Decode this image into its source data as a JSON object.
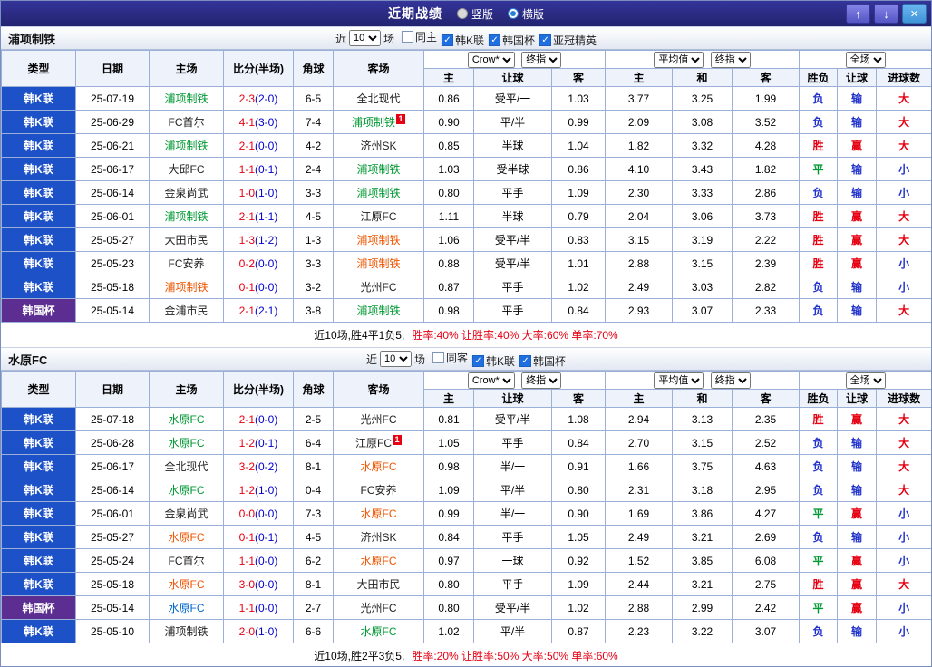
{
  "titlebar": {
    "title": "近期战绩",
    "radio_vertical": "竖版",
    "radio_horizontal": "横版",
    "up_icon": "↑",
    "down_icon": "↓",
    "close_icon": "×"
  },
  "colors": {
    "league": {
      "韩K联": "#1c51c8",
      "韩国杯": "#5c2e91"
    },
    "team": {
      "green": "#009933",
      "red": "#ee5500",
      "blue": "#0066cc",
      "black": "#222222"
    },
    "score_full": "#e60012",
    "score_half": "#0000cc",
    "result": {
      "胜": "#e60012",
      "平": "#009933",
      "负": "#2233cc",
      "赢": "#e60012",
      "输": "#2233cc",
      "大": "#e60012",
      "小": "#2233cc"
    }
  },
  "sections": [
    {
      "team": "浦项制铁",
      "filter": {
        "prefix": "近",
        "count": "10",
        "suffix": "场",
        "checkboxes": [
          {
            "label": "同主",
            "checked": false
          },
          {
            "label": "韩K联",
            "checked": true
          },
          {
            "label": "韩国杯",
            "checked": true
          },
          {
            "label": "亚冠精英",
            "checked": true
          }
        ]
      },
      "table": {
        "headers": [
          "类型",
          "日期",
          "主场",
          "比分(半场)",
          "角球",
          "客场"
        ],
        "odds_group1": {
          "select1": "Crow*",
          "select2": "终指",
          "cols": [
            "主",
            "让球",
            "客"
          ]
        },
        "odds_group2": {
          "select1": "平均值",
          "select2": "终指",
          "cols": [
            "主",
            "和",
            "客"
          ]
        },
        "result_group": {
          "select1": "全场",
          "cols": [
            "胜负",
            "让球",
            "进球数"
          ]
        },
        "rows": [
          {
            "league": "韩K联",
            "date": "25-07-19",
            "home": {
              "name": "浦项制铁",
              "c": "green"
            },
            "score": {
              "full": "2-3",
              "half": "(2-0)"
            },
            "corner": "6-5",
            "away": {
              "name": "全北现代",
              "c": "black"
            },
            "odds1": [
              "0.86",
              "受平/一",
              "1.03"
            ],
            "odds2": [
              "3.77",
              "3.25",
              "1.99"
            ],
            "result": [
              "负",
              "输",
              "大"
            ]
          },
          {
            "league": "韩K联",
            "date": "25-06-29",
            "home": {
              "name": "FC首尔",
              "c": "black"
            },
            "score": {
              "full": "4-1",
              "half": "(3-0)"
            },
            "corner": "7-4",
            "away": {
              "name": "浦项制铁",
              "c": "green",
              "badge": "1"
            },
            "odds1": [
              "0.90",
              "平/半",
              "0.99"
            ],
            "odds2": [
              "2.09",
              "3.08",
              "3.52"
            ],
            "result": [
              "负",
              "输",
              "大"
            ]
          },
          {
            "league": "韩K联",
            "date": "25-06-21",
            "home": {
              "name": "浦项制铁",
              "c": "green"
            },
            "score": {
              "full": "2-1",
              "half": "(0-0)"
            },
            "corner": "4-2",
            "away": {
              "name": "济州SK",
              "c": "black"
            },
            "odds1": [
              "0.85",
              "半球",
              "1.04"
            ],
            "odds2": [
              "1.82",
              "3.32",
              "4.28"
            ],
            "result": [
              "胜",
              "赢",
              "大"
            ]
          },
          {
            "league": "韩K联",
            "date": "25-06-17",
            "home": {
              "name": "大邱FC",
              "c": "black"
            },
            "score": {
              "full": "1-1",
              "half": "(0-1)"
            },
            "corner": "2-4",
            "away": {
              "name": "浦项制铁",
              "c": "green"
            },
            "odds1": [
              "1.03",
              "受半球",
              "0.86"
            ],
            "odds2": [
              "4.10",
              "3.43",
              "1.82"
            ],
            "result": [
              "平",
              "输",
              "小"
            ]
          },
          {
            "league": "韩K联",
            "date": "25-06-14",
            "home": {
              "name": "金泉尚武",
              "c": "black"
            },
            "score": {
              "full": "1-0",
              "half": "(1-0)"
            },
            "corner": "3-3",
            "away": {
              "name": "浦项制铁",
              "c": "green"
            },
            "odds1": [
              "0.80",
              "平手",
              "1.09"
            ],
            "odds2": [
              "2.30",
              "3.33",
              "2.86"
            ],
            "result": [
              "负",
              "输",
              "小"
            ]
          },
          {
            "league": "韩K联",
            "date": "25-06-01",
            "home": {
              "name": "浦项制铁",
              "c": "green"
            },
            "score": {
              "full": "2-1",
              "half": "(1-1)"
            },
            "corner": "4-5",
            "away": {
              "name": "江原FC",
              "c": "black"
            },
            "odds1": [
              "1.11",
              "半球",
              "0.79"
            ],
            "odds2": [
              "2.04",
              "3.06",
              "3.73"
            ],
            "result": [
              "胜",
              "赢",
              "大"
            ]
          },
          {
            "league": "韩K联",
            "date": "25-05-27",
            "home": {
              "name": "大田市民",
              "c": "black"
            },
            "score": {
              "full": "1-3",
              "half": "(1-2)"
            },
            "corner": "1-3",
            "away": {
              "name": "浦项制铁",
              "c": "red"
            },
            "odds1": [
              "1.06",
              "受平/半",
              "0.83"
            ],
            "odds2": [
              "3.15",
              "3.19",
              "2.22"
            ],
            "result": [
              "胜",
              "赢",
              "大"
            ]
          },
          {
            "league": "韩K联",
            "date": "25-05-23",
            "home": {
              "name": "FC安养",
              "c": "black"
            },
            "score": {
              "full": "0-2",
              "half": "(0-0)"
            },
            "corner": "3-3",
            "away": {
              "name": "浦项制铁",
              "c": "red"
            },
            "odds1": [
              "0.88",
              "受平/半",
              "1.01"
            ],
            "odds2": [
              "2.88",
              "3.15",
              "2.39"
            ],
            "result": [
              "胜",
              "赢",
              "小"
            ]
          },
          {
            "league": "韩K联",
            "date": "25-05-18",
            "home": {
              "name": "浦项制铁",
              "c": "red"
            },
            "score": {
              "full": "0-1",
              "half": "(0-0)"
            },
            "corner": "3-2",
            "away": {
              "name": "光州FC",
              "c": "black"
            },
            "odds1": [
              "0.87",
              "平手",
              "1.02"
            ],
            "odds2": [
              "2.49",
              "3.03",
              "2.82"
            ],
            "result": [
              "负",
              "输",
              "小"
            ]
          },
          {
            "league": "韩国杯",
            "date": "25-05-14",
            "home": {
              "name": "金浦市民",
              "c": "black"
            },
            "score": {
              "full": "2-1",
              "half": "(2-1)"
            },
            "corner": "3-8",
            "away": {
              "name": "浦项制铁",
              "c": "green"
            },
            "odds1": [
              "0.98",
              "平手",
              "0.84"
            ],
            "odds2": [
              "2.93",
              "3.07",
              "2.33"
            ],
            "result": [
              "负",
              "输",
              "大"
            ]
          }
        ]
      },
      "summary": {
        "text": "近10场,胜4平1负5,",
        "stats": "胜率:40% 让胜率:40% 大率:60% 单率:70%"
      }
    },
    {
      "team": "水原FC",
      "filter": {
        "prefix": "近",
        "count": "10",
        "suffix": "场",
        "checkboxes": [
          {
            "label": "同客",
            "checked": false
          },
          {
            "label": "韩K联",
            "checked": true
          },
          {
            "label": "韩国杯",
            "checked": true
          }
        ]
      },
      "table": {
        "headers": [
          "类型",
          "日期",
          "主场",
          "比分(半场)",
          "角球",
          "客场"
        ],
        "odds_group1": {
          "select1": "Crow*",
          "select2": "终指",
          "cols": [
            "主",
            "让球",
            "客"
          ]
        },
        "odds_group2": {
          "select1": "平均值",
          "select2": "终指",
          "cols": [
            "主",
            "和",
            "客"
          ]
        },
        "result_group": {
          "select1": "全场",
          "cols": [
            "胜负",
            "让球",
            "进球数"
          ]
        },
        "rows": [
          {
            "league": "韩K联",
            "date": "25-07-18",
            "home": {
              "name": "水原FC",
              "c": "green"
            },
            "score": {
              "full": "2-1",
              "half": "(0-0)"
            },
            "corner": "2-5",
            "away": {
              "name": "光州FC",
              "c": "black"
            },
            "odds1": [
              "0.81",
              "受平/半",
              "1.08"
            ],
            "odds2": [
              "2.94",
              "3.13",
              "2.35"
            ],
            "result": [
              "胜",
              "赢",
              "大"
            ]
          },
          {
            "league": "韩K联",
            "date": "25-06-28",
            "home": {
              "name": "水原FC",
              "c": "green"
            },
            "score": {
              "full": "1-2",
              "half": "(0-1)"
            },
            "corner": "6-4",
            "away": {
              "name": "江原FC",
              "c": "black",
              "badge": "1"
            },
            "odds1": [
              "1.05",
              "平手",
              "0.84"
            ],
            "odds2": [
              "2.70",
              "3.15",
              "2.52"
            ],
            "result": [
              "负",
              "输",
              "大"
            ]
          },
          {
            "league": "韩K联",
            "date": "25-06-17",
            "home": {
              "name": "全北现代",
              "c": "black"
            },
            "score": {
              "full": "3-2",
              "half": "(0-2)"
            },
            "corner": "8-1",
            "away": {
              "name": "水原FC",
              "c": "red"
            },
            "odds1": [
              "0.98",
              "半/一",
              "0.91"
            ],
            "odds2": [
              "1.66",
              "3.75",
              "4.63"
            ],
            "result": [
              "负",
              "输",
              "大"
            ]
          },
          {
            "league": "韩K联",
            "date": "25-06-14",
            "home": {
              "name": "水原FC",
              "c": "green"
            },
            "score": {
              "full": "1-2",
              "half": "(1-0)"
            },
            "corner": "0-4",
            "away": {
              "name": "FC安养",
              "c": "black"
            },
            "odds1": [
              "1.09",
              "平/半",
              "0.80"
            ],
            "odds2": [
              "2.31",
              "3.18",
              "2.95"
            ],
            "result": [
              "负",
              "输",
              "大"
            ]
          },
          {
            "league": "韩K联",
            "date": "25-06-01",
            "home": {
              "name": "金泉尚武",
              "c": "black"
            },
            "score": {
              "full": "0-0",
              "half": "(0-0)"
            },
            "corner": "7-3",
            "away": {
              "name": "水原FC",
              "c": "red"
            },
            "odds1": [
              "0.99",
              "半/一",
              "0.90"
            ],
            "odds2": [
              "1.69",
              "3.86",
              "4.27"
            ],
            "result": [
              "平",
              "赢",
              "小"
            ]
          },
          {
            "league": "韩K联",
            "date": "25-05-27",
            "home": {
              "name": "水原FC",
              "c": "red"
            },
            "score": {
              "full": "0-1",
              "half": "(0-1)"
            },
            "corner": "4-5",
            "away": {
              "name": "济州SK",
              "c": "black"
            },
            "odds1": [
              "0.84",
              "平手",
              "1.05"
            ],
            "odds2": [
              "2.49",
              "3.21",
              "2.69"
            ],
            "result": [
              "负",
              "输",
              "小"
            ]
          },
          {
            "league": "韩K联",
            "date": "25-05-24",
            "home": {
              "name": "FC首尔",
              "c": "black"
            },
            "score": {
              "full": "1-1",
              "half": "(0-0)"
            },
            "corner": "6-2",
            "away": {
              "name": "水原FC",
              "c": "red"
            },
            "odds1": [
              "0.97",
              "一球",
              "0.92"
            ],
            "odds2": [
              "1.52",
              "3.85",
              "6.08"
            ],
            "result": [
              "平",
              "赢",
              "小"
            ]
          },
          {
            "league": "韩K联",
            "date": "25-05-18",
            "home": {
              "name": "水原FC",
              "c": "red"
            },
            "score": {
              "full": "3-0",
              "half": "(0-0)"
            },
            "corner": "8-1",
            "away": {
              "name": "大田市民",
              "c": "black"
            },
            "odds1": [
              "0.80",
              "平手",
              "1.09"
            ],
            "odds2": [
              "2.44",
              "3.21",
              "2.75"
            ],
            "result": [
              "胜",
              "赢",
              "大"
            ]
          },
          {
            "league": "韩国杯",
            "date": "25-05-14",
            "home": {
              "name": "水原FC",
              "c": "blue"
            },
            "score": {
              "full": "1-1",
              "half": "(0-0)"
            },
            "corner": "2-7",
            "away": {
              "name": "光州FC",
              "c": "black"
            },
            "odds1": [
              "0.80",
              "受平/半",
              "1.02"
            ],
            "odds2": [
              "2.88",
              "2.99",
              "2.42"
            ],
            "result": [
              "平",
              "赢",
              "小"
            ]
          },
          {
            "league": "韩K联",
            "date": "25-05-10",
            "home": {
              "name": "浦项制铁",
              "c": "black"
            },
            "score": {
              "full": "2-0",
              "half": "(1-0)"
            },
            "corner": "6-6",
            "away": {
              "name": "水原FC",
              "c": "green"
            },
            "odds1": [
              "1.02",
              "平/半",
              "0.87"
            ],
            "odds2": [
              "2.23",
              "3.22",
              "3.07"
            ],
            "result": [
              "负",
              "输",
              "小"
            ]
          }
        ]
      },
      "summary": {
        "text": "近10场,胜2平3负5,",
        "stats": "胜率:20% 让胜率:50% 大率:50% 单率:60%"
      }
    }
  ]
}
